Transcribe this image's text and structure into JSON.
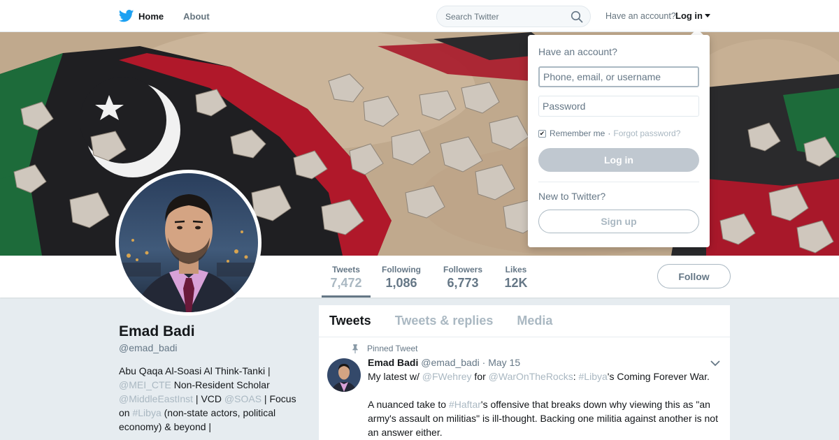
{
  "nav": {
    "home_label": "Home",
    "about_label": "About",
    "search_placeholder": "Search Twitter",
    "have_account": "Have an account?",
    "login_label": "Log in"
  },
  "profile": {
    "name": "Emad Badi",
    "handle": "@emad_badi",
    "bio": {
      "line1_text": "Abu Qaqa Al-Soasi Al Think-Tanki | ",
      "mention1": "@MEI_CTE",
      "text2": " Non-Resident Scholar ",
      "mention2": "@MiddleEastInst",
      "text3": " | VCD ",
      "mention3": "@SOAS",
      "text4": " | Focus on ",
      "hashtag1": "#Libya",
      "text5": " (non-state actors, political economy) & beyond |"
    }
  },
  "stats": [
    {
      "label": "Tweets",
      "value": "7,472"
    },
    {
      "label": "Following",
      "value": "1,086"
    },
    {
      "label": "Followers",
      "value": "6,773"
    },
    {
      "label": "Likes",
      "value": "12K"
    }
  ],
  "follow_label": "Follow",
  "timeline": {
    "tabs": [
      "Tweets",
      "Tweets & replies",
      "Media"
    ],
    "pinned_label": "Pinned Tweet",
    "tweet": {
      "name": "Emad Badi",
      "handle": "@emad_badi",
      "separator": "·",
      "date": "May 15",
      "p1_a": "My latest w/ ",
      "p1_m1": "@FWehrey",
      "p1_b": " for ",
      "p1_m2": "@WarOnTheRocks",
      "p1_c": ": ",
      "p1_h": "#Libya",
      "p1_d": "'s Coming Forever War.",
      "p2_a": "A nuanced take to ",
      "p2_h": "#Haftar",
      "p2_b": "'s offensive that breaks down why viewing this as \"an army's assault on militias\" is ill-thought. Backing one militia against another is not an answer either."
    }
  },
  "login_dropdown": {
    "title": "Have an account?",
    "username_placeholder": "Phone, email, or username",
    "password_placeholder": "Password",
    "remember_label": "Remember me",
    "separator": "·",
    "forgot_label": "Forgot password?",
    "login_button": "Log in",
    "new_label": "New to Twitter?",
    "signup_button": "Sign up"
  },
  "colors": {
    "brand": "#1da1f2",
    "text": "#14171a",
    "secondary": "#657786",
    "muted": "#aab8c2",
    "background": "#e6ecf0"
  },
  "icons": [
    "twitter-bird-icon",
    "search-icon",
    "caret-down-icon",
    "pin-icon",
    "chevron-down-icon",
    "checkbox-checked-icon"
  ]
}
